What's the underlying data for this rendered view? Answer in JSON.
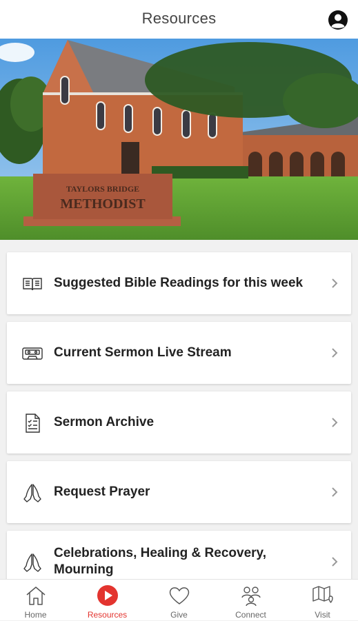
{
  "header": {
    "title": "Resources"
  },
  "hero": {
    "sign_line1": "TAYLORS BRIDGE",
    "sign_line2": "METHODIST"
  },
  "menu": [
    {
      "label": "Suggested Bible Readings for this week",
      "icon": "open-book-icon"
    },
    {
      "label": "Current Sermon Live Stream",
      "icon": "cassette-icon"
    },
    {
      "label": "Sermon Archive",
      "icon": "checklist-document-icon"
    },
    {
      "label": "Request Prayer",
      "icon": "praying-hands-icon"
    },
    {
      "label": "Celebrations, Healing & Recovery, Mourning",
      "icon": "praying-hands-icon"
    }
  ],
  "tabs": [
    {
      "label": "Home",
      "icon": "home-icon",
      "active": false
    },
    {
      "label": "Resources",
      "icon": "play-icon",
      "active": true
    },
    {
      "label": "Give",
      "icon": "heart-icon",
      "active": false
    },
    {
      "label": "Connect",
      "icon": "people-icon",
      "active": false
    },
    {
      "label": "Visit",
      "icon": "map-icon",
      "active": false
    }
  ],
  "colors": {
    "accent": "#e3342f",
    "text": "#222222",
    "background": "#f1f1f1"
  }
}
